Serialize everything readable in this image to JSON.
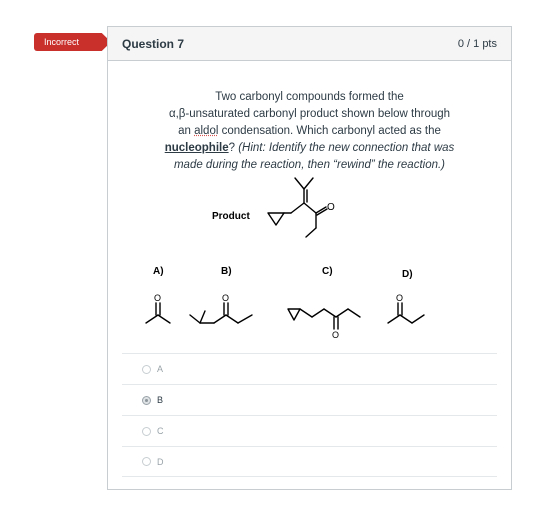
{
  "badge": {
    "label": "Incorrect",
    "color": "#c9302c"
  },
  "question": {
    "title": "Question 7",
    "points": "0 / 1 pts",
    "text_line1": "Two carbonyl compounds formed the",
    "text_line2": "α,β-unsaturated carbonyl product shown below through",
    "text_line3_a": "an ",
    "text_line3_b": "aldol",
    "text_line3_c": " condensation. Which carbonyl acted as the",
    "text_line4_a": "nucleophile",
    "text_line4_b": "? ",
    "text_line4_c": "(Hint: Identify the new connection that was",
    "text_line5": "made during the reaction, then “rewind” the reaction.)"
  },
  "figure": {
    "product_label": "Product",
    "option_labels": [
      "A)",
      "B)",
      "C)",
      "D)"
    ],
    "oxygen": "O"
  },
  "answers": [
    {
      "letter": "A",
      "selected": false
    },
    {
      "letter": "B",
      "selected": true
    },
    {
      "letter": "C",
      "selected": false
    },
    {
      "letter": "D",
      "selected": false
    }
  ]
}
